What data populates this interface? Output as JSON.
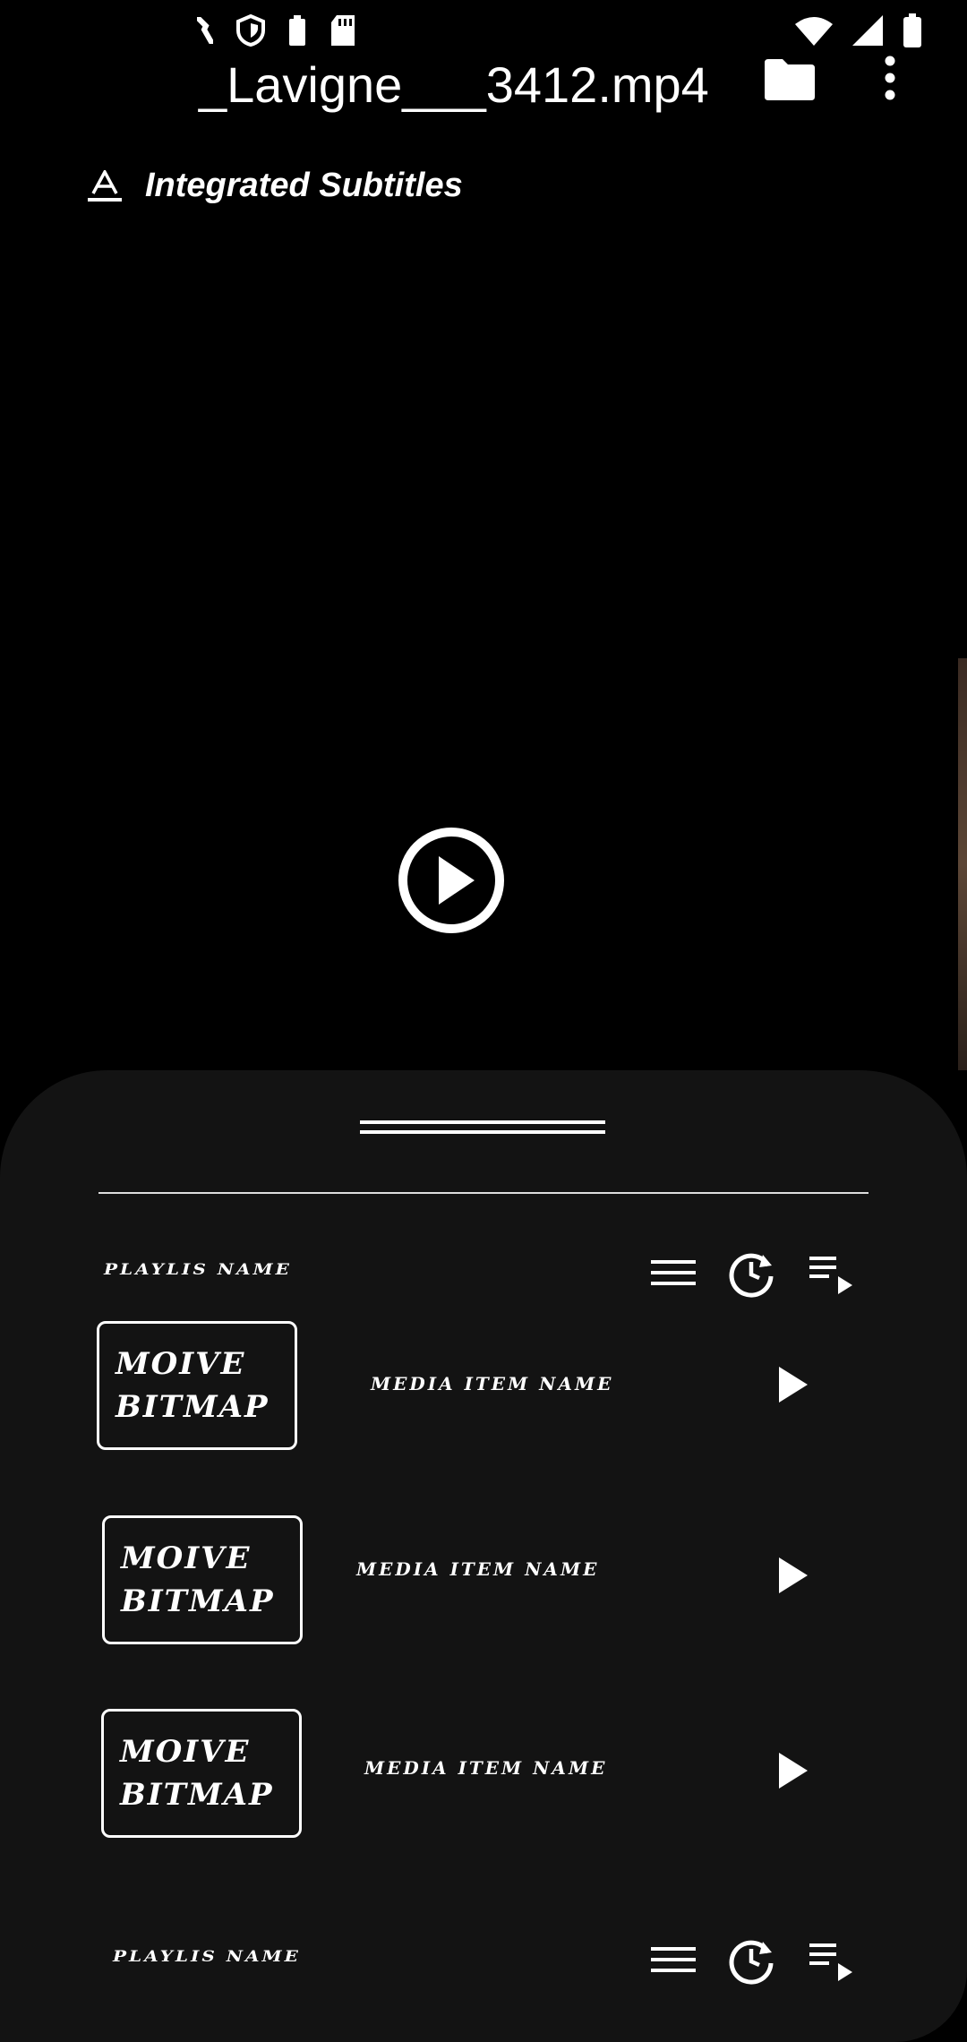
{
  "header": {
    "title": "_Lavigne___3412.mp4",
    "subtitles_label": "Integrated Subtitles"
  },
  "status_bar": {
    "left_icons": [
      "phone-icon",
      "shield-icon",
      "battery-small-icon",
      "sd-card-icon"
    ],
    "right_icons": [
      "wifi-icon",
      "signal-icon",
      "battery-icon"
    ]
  },
  "toolbar": {
    "icons": [
      "folder-icon",
      "more-vertical-icon"
    ]
  },
  "player": {
    "center_icon": "play-circle-icon"
  },
  "sheet": {
    "playlists": [
      {
        "name": "PLAYLIS NAME",
        "icons": [
          "menu-icon",
          "history-icon",
          "queue-play-icon"
        ],
        "items": [
          {
            "thumb_line1": "MOIVE",
            "thumb_line2": "BITMAP",
            "name": "MEDIA ITEM NAME"
          },
          {
            "thumb_line1": "MOIVE",
            "thumb_line2": "BITMAP",
            "name": "MEDIA ITEM NAME"
          },
          {
            "thumb_line1": "MOIVE",
            "thumb_line2": "BITMAP",
            "name": "MEDIA ITEM NAME"
          }
        ]
      },
      {
        "name": "PLAYLIS NAME",
        "icons": [
          "menu-icon",
          "history-icon",
          "queue-play-icon"
        ],
        "items": []
      }
    ]
  },
  "colors": {
    "background": "#000000",
    "sheet": "#131313",
    "foreground": "#ffffff"
  }
}
